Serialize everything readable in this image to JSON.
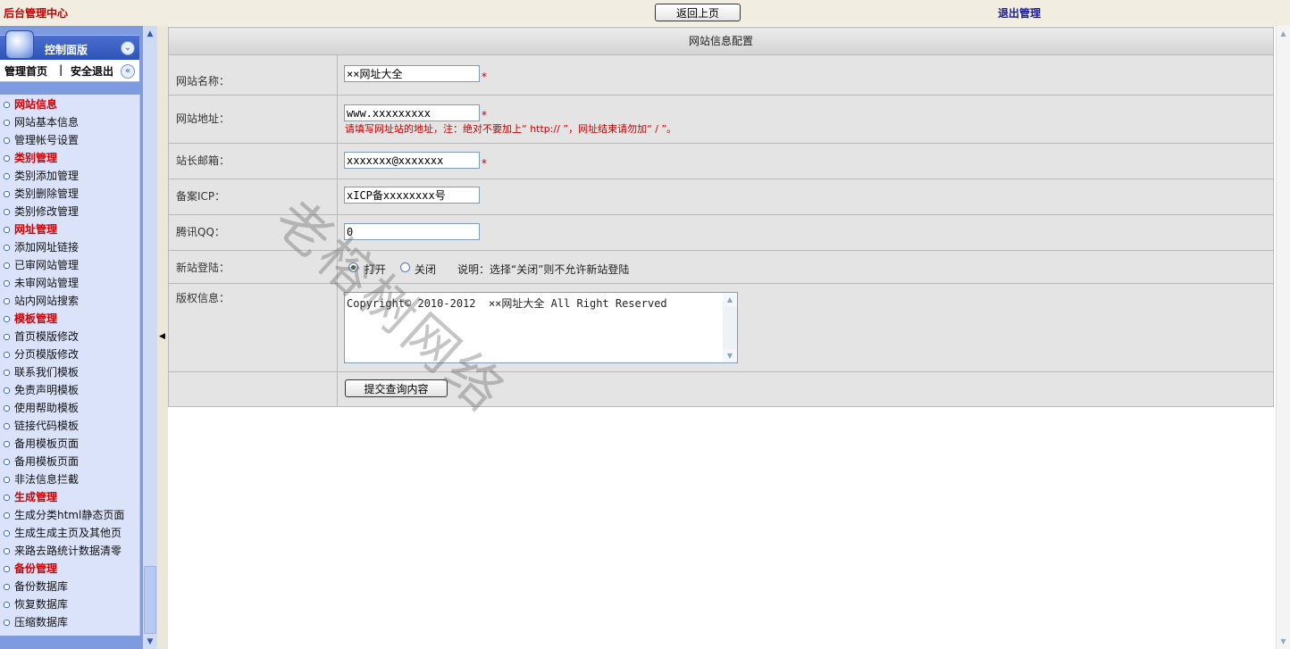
{
  "topbar": {
    "title": "后台管理中心",
    "back_button": "返回上页",
    "logout": "退出管理"
  },
  "panel": {
    "title": "控制面版",
    "home_link": "管理首页",
    "separator": "|",
    "exit_link": "安全退出",
    "collapse_icon": "double-chevron"
  },
  "menu": [
    {
      "label": "网站信息",
      "type": "category"
    },
    {
      "label": "网站基本信息",
      "type": "item"
    },
    {
      "label": "管理帐号设置",
      "type": "item"
    },
    {
      "label": "类别管理",
      "type": "category"
    },
    {
      "label": "类别添加管理",
      "type": "item"
    },
    {
      "label": "类别删除管理",
      "type": "item"
    },
    {
      "label": "类别修改管理",
      "type": "item"
    },
    {
      "label": "网址管理",
      "type": "category"
    },
    {
      "label": "添加网址链接",
      "type": "item"
    },
    {
      "label": "已审网站管理",
      "type": "item"
    },
    {
      "label": "未审网站管理",
      "type": "item"
    },
    {
      "label": "站内网站搜索",
      "type": "item"
    },
    {
      "label": "模板管理",
      "type": "category"
    },
    {
      "label": "首页模版修改",
      "type": "item"
    },
    {
      "label": "分页模版修改",
      "type": "item"
    },
    {
      "label": "联系我们模板",
      "type": "item"
    },
    {
      "label": "免责声明模板",
      "type": "item"
    },
    {
      "label": "使用帮助模板",
      "type": "item"
    },
    {
      "label": "链接代码模板",
      "type": "item"
    },
    {
      "label": "备用模板页面",
      "type": "item"
    },
    {
      "label": "备用模板页面",
      "type": "item"
    },
    {
      "label": "非法信息拦截",
      "type": "item"
    },
    {
      "label": "生成管理",
      "type": "category"
    },
    {
      "label": "生成分类html静态页面",
      "type": "item"
    },
    {
      "label": "生成生成主页及其他页",
      "type": "item"
    },
    {
      "label": "来路去路统计数据清零",
      "type": "item"
    },
    {
      "label": "备份管理",
      "type": "category"
    },
    {
      "label": "备份数据库",
      "type": "item"
    },
    {
      "label": "恢复数据库",
      "type": "item"
    },
    {
      "label": "压缩数据库",
      "type": "item"
    }
  ],
  "form": {
    "header": "网站信息配置",
    "site_name": {
      "label": "网站名称：",
      "value": "××网址大全",
      "required": "*"
    },
    "site_url": {
      "label": "网站地址：",
      "value": "www.xxxxxxxxx",
      "required": "*",
      "hint": "请填写网址站的地址，注：绝对不要加上“ http:// ”，网址结束请勿加“ / ”。"
    },
    "admin_email": {
      "label": "站长邮箱：",
      "value": "xxxxxxx@xxxxxxx",
      "required": "*"
    },
    "icp": {
      "label": "备案ICP：",
      "value": "xICP备xxxxxxxx号"
    },
    "qq": {
      "label": "腾讯QQ：",
      "value": "0"
    },
    "registration": {
      "label": "新站登陆：",
      "open": "打开",
      "close": "关闭",
      "note": "说明：选择“关闭”则不允许新站登陆",
      "selected": "open"
    },
    "copyright": {
      "label": "版权信息：",
      "value": "Copyright© 2010-2012  ××网址大全 All Right Reserved"
    },
    "submit": "提交查询内容"
  },
  "watermark": "老榕树网络"
}
